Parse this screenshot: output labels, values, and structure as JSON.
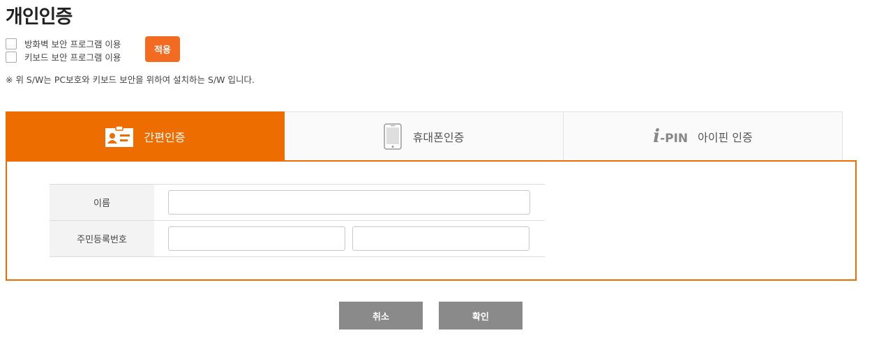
{
  "page": {
    "title": "개인인증"
  },
  "security": {
    "options": [
      {
        "label": "방화벽 보안 프로그램 이용",
        "checked": false
      },
      {
        "label": "키보드 보안 프로그램 이용",
        "checked": false
      }
    ],
    "apply_label": "적용",
    "notice": "※ 위 S/W는 PC보호와 키보드 보안을 위하여 설치하는 S/W 입니다."
  },
  "tabs": [
    {
      "label": "간편인증",
      "icon": "id-card-icon",
      "active": true
    },
    {
      "label": "휴대폰인증",
      "icon": "mobile-phone-icon",
      "active": false
    },
    {
      "label": "아이핀 인증",
      "icon": "ipin-logo",
      "logo_i": "i",
      "logo_text": "-PIN",
      "active": false
    }
  ],
  "form": {
    "name_label": "이름",
    "name_value": "",
    "rrn_label": "주민등록번호",
    "rrn_front_value": "",
    "rrn_back_value": ""
  },
  "actions": {
    "cancel_label": "취소",
    "confirm_label": "확인"
  },
  "colors": {
    "accent": "#ee6d00",
    "apply_button": "#f26b21",
    "action_button": "#8a8a8a"
  }
}
